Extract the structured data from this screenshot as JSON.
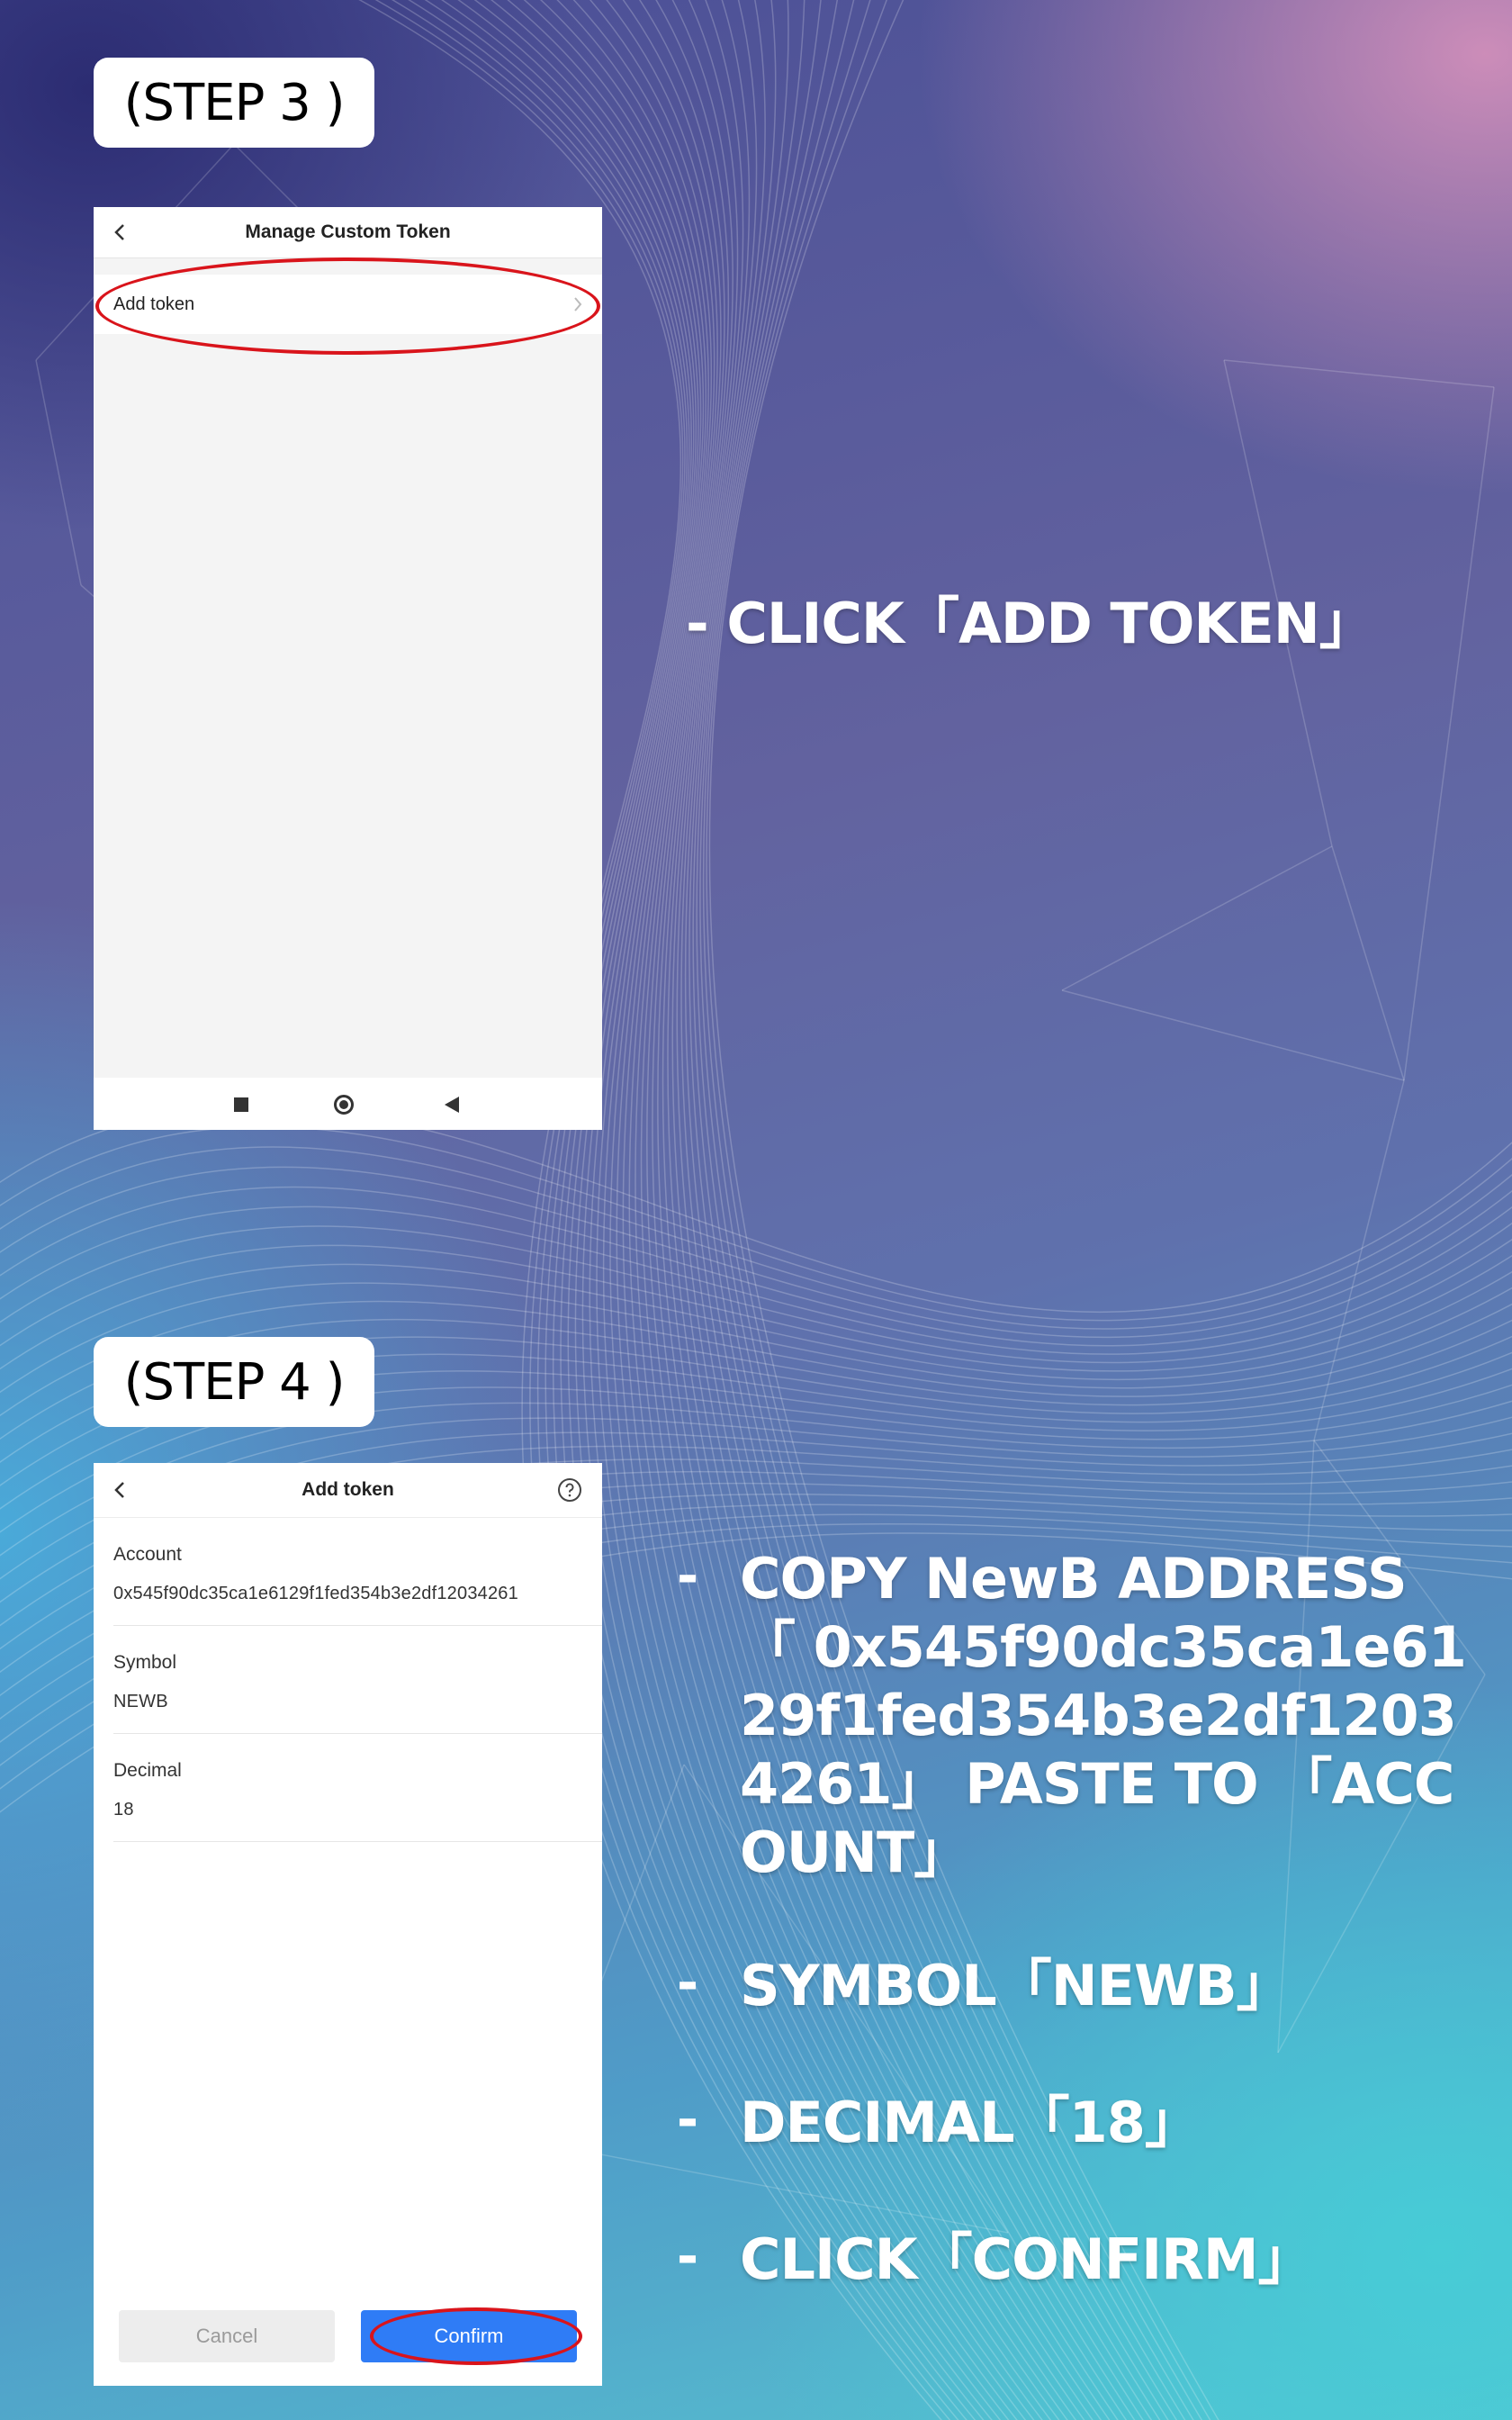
{
  "step3": {
    "label": "(STEP 3 )",
    "screen": {
      "title": "Manage Custom Token",
      "add_token_label": "Add token"
    },
    "instruction": "- CLICK「ADD TOKEN」"
  },
  "step4": {
    "label": "(STEP 4 )",
    "screen": {
      "title": "Add token",
      "fields": [
        {
          "label": "Account",
          "value": "0x545f90dc35ca1e6129f1fed354b3e2df12034261"
        },
        {
          "label": "Symbol",
          "value": "NEWB"
        },
        {
          "label": "Decimal",
          "value": "18"
        }
      ],
      "cancel_label": "Cancel",
      "confirm_label": "Confirm"
    },
    "instructions": [
      "COPY NewB ADDRESS 「 0x545f90dc35ca1e6129f1fed354b3e2df12034261」 PASTE TO 「ACCOUNT」",
      "SYMBOL「NEWB」",
      "DECIMAL「18」",
      "CLICK「CONFIRM」"
    ]
  },
  "dash": "-",
  "colors": {
    "highlight": "#d9141b",
    "confirm": "#2f7cf6"
  }
}
